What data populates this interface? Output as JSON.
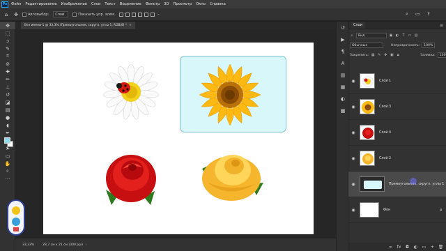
{
  "app": {
    "logo": "Ps"
  },
  "menu": [
    "Файл",
    "Редактирование",
    "Изображение",
    "Слои",
    "Текст",
    "Выделение",
    "Фильтр",
    "3D",
    "Просмотр",
    "Окно",
    "Справка"
  ],
  "options": {
    "autoselect_label": "Автовыбор:",
    "autoselect_value": "Слой",
    "show_controls_label": "Показать упр. элем."
  },
  "document": {
    "tab_title": "Без имени-1 @ 33,3% (Прямоугольник, скругл. углы 1, RGB/8) *",
    "zoom": "33,33%",
    "doc_info": "28,7 см х 21 см (300 ppi)"
  },
  "colors": {
    "foreground": "#8fdbe9",
    "background": "#ffffff",
    "shape_fill": "#d8f7fb",
    "accent": "#31a8ff"
  },
  "layers_panel": {
    "title": "Слои",
    "filter": "Вид",
    "blend_mode": "Обычные",
    "opacity_label": "Непрозрачность:",
    "opacity_value": "100%",
    "lock_label": "Закрепить:",
    "fill_label": "Заливка:",
    "fill_value": "100%",
    "layers": [
      {
        "name": "Слой 1",
        "thumb": "daisy"
      },
      {
        "name": "Слой 3",
        "thumb": "sunflower"
      },
      {
        "name": "Слой 4",
        "thumb": "red-rose"
      },
      {
        "name": "Слой 2",
        "thumb": "yellow-rose"
      },
      {
        "name": "Прямоугольник, скругл. углы 1",
        "thumb": "rect",
        "selected": true
      },
      {
        "name": "Фон",
        "thumb": "white",
        "locked": true
      }
    ]
  },
  "icons": {
    "tools": [
      "move-icon",
      "marquee-icon",
      "lasso-icon",
      "quick-select-icon",
      "crop-icon",
      "eyedropper-icon",
      "healing-icon",
      "brush-icon",
      "clone-stamp-icon",
      "history-brush-icon",
      "eraser-icon",
      "gradient-icon",
      "blur-icon",
      "dodge-icon",
      "pen-icon",
      "type-icon",
      "path-select-icon",
      "rectangle-icon",
      "hand-icon",
      "zoom-icon",
      "more-tools-icon"
    ]
  }
}
